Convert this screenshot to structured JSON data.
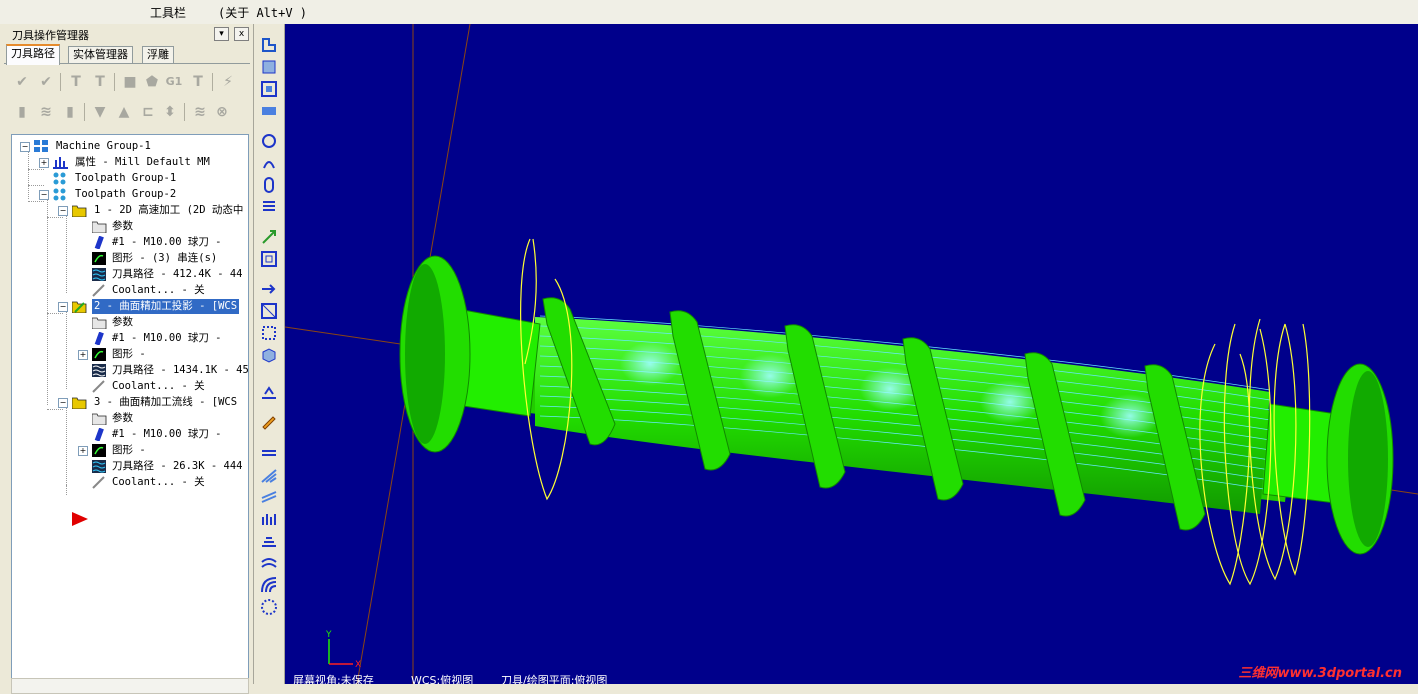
{
  "topbar": {
    "toolbar_label": "工具栏",
    "about_label": "(关于 Alt+V )"
  },
  "panel": {
    "title": "刀具操作管理器",
    "dropdown_glyph": "▾",
    "close_glyph": "x",
    "tabs": [
      "刀具路径",
      "实体管理器",
      "浮雕"
    ]
  },
  "tree": {
    "machine_group": "Machine Group-1",
    "properties": "属性 - Mill Default MM",
    "toolpath_group_1": "Toolpath Group-1",
    "toolpath_group_2": "Toolpath Group-2",
    "op1": {
      "title": "1 - 2D 高速加工 (2D 动态中",
      "params": "参数",
      "tool": "#1 - M10.00 球刀 -",
      "geometry": "图形 - (3) 串连(s)",
      "toolpath": "刀具路径 - 412.4K - 44",
      "coolant": "Coolant... - 关"
    },
    "op2": {
      "title": "2 - 曲面精加工投影 - [WCS",
      "params": "参数",
      "tool": "#1 - M10.00 球刀 -",
      "geometry": "图形 -",
      "toolpath": "刀具路径 - 1434.1K - 45",
      "coolant": "Coolant... - 关"
    },
    "op3": {
      "title": "3 - 曲面精加工流线 - [WCS",
      "params": "参数",
      "tool": "#1 - M10.00 球刀 -",
      "geometry": "图形 -",
      "toolpath": "刀具路径 - 26.3K - 444",
      "coolant": "Coolant... - 关"
    }
  },
  "viewport": {
    "axis_y": "Y",
    "axis_x": "X",
    "status": [
      "屏幕视角:未保存",
      "WCS:俯视图",
      "刀具/绘图平面:俯视图"
    ],
    "watermark": "三维网www.3dportal.cn"
  },
  "colors": {
    "viewport_bg": "#00008b",
    "part_green": "#22dd00",
    "toolpath_cyan": "#66e8ff",
    "path_yellow": "#ffff33",
    "axis_brown": "#8b4513"
  },
  "icons": {
    "row1": [
      "verify-all-icon",
      "verify-clear-icon",
      "toolpath-select-icon",
      "toolpath-clear-icon",
      "stop-icon",
      "solid-icon",
      "g1-icon",
      "post-icon",
      "magic-icon"
    ],
    "row2": [
      "lock-icon",
      "wave-icon",
      "lock2-icon",
      "move-down-icon",
      "move-up-icon",
      "insert-icon",
      "expand-icon",
      "wave2-icon",
      "loop-icon"
    ],
    "g1_text": "G1"
  }
}
